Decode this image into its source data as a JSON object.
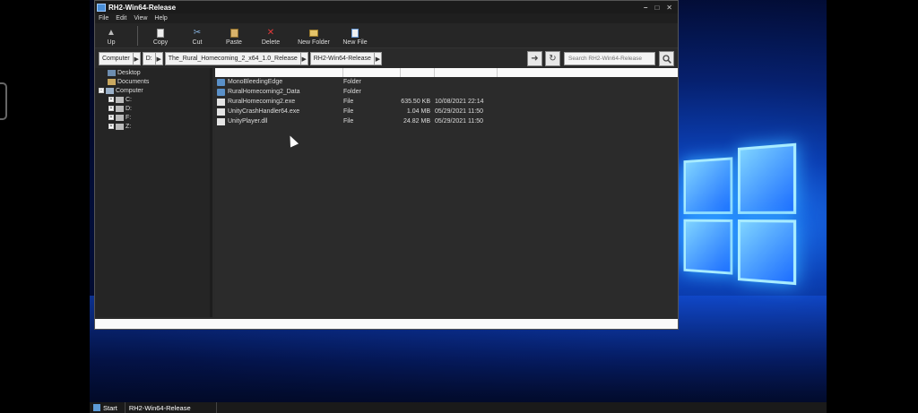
{
  "window": {
    "title": "RH2-Win64-Release",
    "controls": {
      "minimize": "–",
      "maximize": "□",
      "close": "✕"
    }
  },
  "menu": [
    "File",
    "Edit",
    "View",
    "Help"
  ],
  "toolbar": {
    "up": "Up",
    "copy": "Copy",
    "cut": "Cut",
    "paste": "Paste",
    "delete": "Delete",
    "new_folder": "New Folder",
    "new_file": "New File"
  },
  "address": {
    "crumbs": [
      "Computer",
      "D:",
      "The_Rural_Homecoming_2_x64_1.0_Release",
      "RH2-Win64-Release"
    ]
  },
  "search": {
    "placeholder": "Search RH2-Win64-Release"
  },
  "tree": {
    "desktop": "Desktop",
    "documents": "Documents",
    "computer": "Computer",
    "drives": [
      "C:",
      "D:",
      "F:",
      "Z:"
    ]
  },
  "files": [
    {
      "name": "MonoBleedingEdge",
      "type": "Folder",
      "size": "",
      "date": "",
      "kind": "folder"
    },
    {
      "name": "RuralHomecoming2_Data",
      "type": "Folder",
      "size": "",
      "date": "",
      "kind": "folder"
    },
    {
      "name": "RuralHomecoming2.exe",
      "type": "File",
      "size": "635.50 KB",
      "date": "10/08/2021 22:14",
      "kind": "file"
    },
    {
      "name": "UnityCrashHandler64.exe",
      "type": "File",
      "size": "1.04 MB",
      "date": "05/29/2021 11:50",
      "kind": "file"
    },
    {
      "name": "UnityPlayer.dll",
      "type": "File",
      "size": "24.82 MB",
      "date": "05/29/2021 11:50",
      "kind": "file"
    }
  ],
  "taskbar": {
    "start": "Start",
    "item": "RH2-Win64-Release"
  },
  "colors": {
    "accent": "#4a8fd8",
    "window_bg": "#2a2a2a",
    "desktop_glow": "#1e7cff"
  }
}
